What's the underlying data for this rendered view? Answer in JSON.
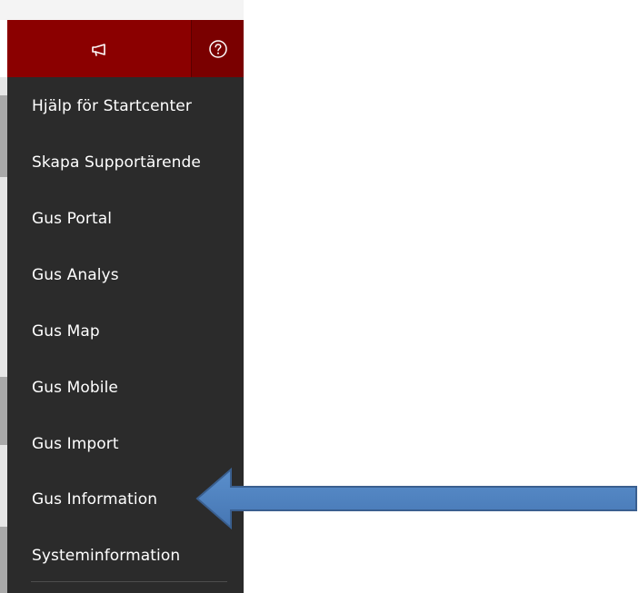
{
  "toolbar": {
    "announce_icon": "megaphone-icon",
    "help_icon": "question-circle-icon",
    "accent_color": "#8b0000"
  },
  "menu": {
    "items": [
      {
        "label": "Hjälp för Startcenter"
      },
      {
        "label": "Skapa Supportärende"
      },
      {
        "label": "Gus Portal"
      },
      {
        "label": "Gus Analys"
      },
      {
        "label": "Gus Map"
      },
      {
        "label": "Gus Mobile"
      },
      {
        "label": "Gus Import"
      },
      {
        "label": "Gus Information"
      },
      {
        "label": "Systeminformation"
      }
    ],
    "background_color": "#2b2b2b"
  },
  "annotation": {
    "arrow_color": "#4f81bd",
    "points_to": "Gus Information"
  }
}
